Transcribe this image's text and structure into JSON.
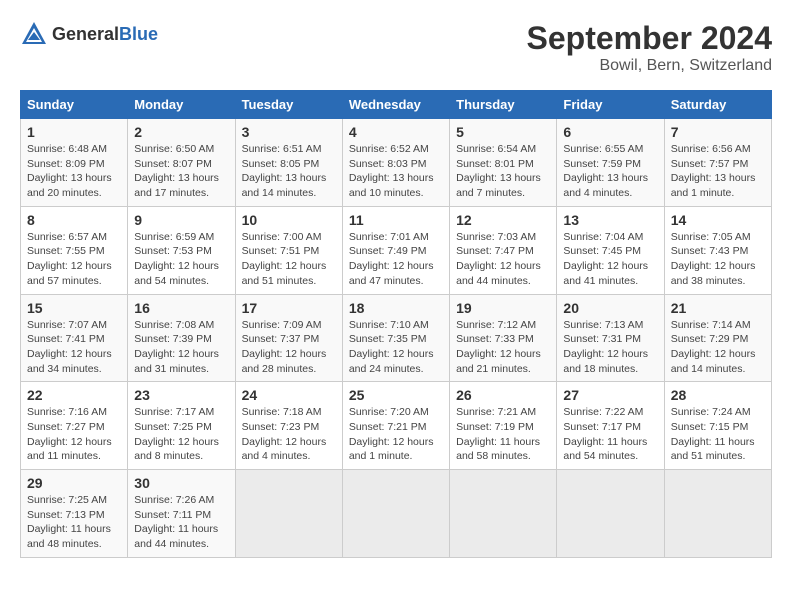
{
  "header": {
    "logo_general": "General",
    "logo_blue": "Blue",
    "month": "September 2024",
    "location": "Bowil, Bern, Switzerland"
  },
  "columns": [
    "Sunday",
    "Monday",
    "Tuesday",
    "Wednesday",
    "Thursday",
    "Friday",
    "Saturday"
  ],
  "weeks": [
    [
      {
        "day": "1",
        "sunrise": "6:48 AM",
        "sunset": "8:09 PM",
        "daylight": "13 hours and 20 minutes."
      },
      {
        "day": "2",
        "sunrise": "6:50 AM",
        "sunset": "8:07 PM",
        "daylight": "13 hours and 17 minutes."
      },
      {
        "day": "3",
        "sunrise": "6:51 AM",
        "sunset": "8:05 PM",
        "daylight": "13 hours and 14 minutes."
      },
      {
        "day": "4",
        "sunrise": "6:52 AM",
        "sunset": "8:03 PM",
        "daylight": "13 hours and 10 minutes."
      },
      {
        "day": "5",
        "sunrise": "6:54 AM",
        "sunset": "8:01 PM",
        "daylight": "13 hours and 7 minutes."
      },
      {
        "day": "6",
        "sunrise": "6:55 AM",
        "sunset": "7:59 PM",
        "daylight": "13 hours and 4 minutes."
      },
      {
        "day": "7",
        "sunrise": "6:56 AM",
        "sunset": "7:57 PM",
        "daylight": "13 hours and 1 minute."
      }
    ],
    [
      {
        "day": "8",
        "sunrise": "6:57 AM",
        "sunset": "7:55 PM",
        "daylight": "12 hours and 57 minutes."
      },
      {
        "day": "9",
        "sunrise": "6:59 AM",
        "sunset": "7:53 PM",
        "daylight": "12 hours and 54 minutes."
      },
      {
        "day": "10",
        "sunrise": "7:00 AM",
        "sunset": "7:51 PM",
        "daylight": "12 hours and 51 minutes."
      },
      {
        "day": "11",
        "sunrise": "7:01 AM",
        "sunset": "7:49 PM",
        "daylight": "12 hours and 47 minutes."
      },
      {
        "day": "12",
        "sunrise": "7:03 AM",
        "sunset": "7:47 PM",
        "daylight": "12 hours and 44 minutes."
      },
      {
        "day": "13",
        "sunrise": "7:04 AM",
        "sunset": "7:45 PM",
        "daylight": "12 hours and 41 minutes."
      },
      {
        "day": "14",
        "sunrise": "7:05 AM",
        "sunset": "7:43 PM",
        "daylight": "12 hours and 38 minutes."
      }
    ],
    [
      {
        "day": "15",
        "sunrise": "7:07 AM",
        "sunset": "7:41 PM",
        "daylight": "12 hours and 34 minutes."
      },
      {
        "day": "16",
        "sunrise": "7:08 AM",
        "sunset": "7:39 PM",
        "daylight": "12 hours and 31 minutes."
      },
      {
        "day": "17",
        "sunrise": "7:09 AM",
        "sunset": "7:37 PM",
        "daylight": "12 hours and 28 minutes."
      },
      {
        "day": "18",
        "sunrise": "7:10 AM",
        "sunset": "7:35 PM",
        "daylight": "12 hours and 24 minutes."
      },
      {
        "day": "19",
        "sunrise": "7:12 AM",
        "sunset": "7:33 PM",
        "daylight": "12 hours and 21 minutes."
      },
      {
        "day": "20",
        "sunrise": "7:13 AM",
        "sunset": "7:31 PM",
        "daylight": "12 hours and 18 minutes."
      },
      {
        "day": "21",
        "sunrise": "7:14 AM",
        "sunset": "7:29 PM",
        "daylight": "12 hours and 14 minutes."
      }
    ],
    [
      {
        "day": "22",
        "sunrise": "7:16 AM",
        "sunset": "7:27 PM",
        "daylight": "12 hours and 11 minutes."
      },
      {
        "day": "23",
        "sunrise": "7:17 AM",
        "sunset": "7:25 PM",
        "daylight": "12 hours and 8 minutes."
      },
      {
        "day": "24",
        "sunrise": "7:18 AM",
        "sunset": "7:23 PM",
        "daylight": "12 hours and 4 minutes."
      },
      {
        "day": "25",
        "sunrise": "7:20 AM",
        "sunset": "7:21 PM",
        "daylight": "12 hours and 1 minute."
      },
      {
        "day": "26",
        "sunrise": "7:21 AM",
        "sunset": "7:19 PM",
        "daylight": "11 hours and 58 minutes."
      },
      {
        "day": "27",
        "sunrise": "7:22 AM",
        "sunset": "7:17 PM",
        "daylight": "11 hours and 54 minutes."
      },
      {
        "day": "28",
        "sunrise": "7:24 AM",
        "sunset": "7:15 PM",
        "daylight": "11 hours and 51 minutes."
      }
    ],
    [
      {
        "day": "29",
        "sunrise": "7:25 AM",
        "sunset": "7:13 PM",
        "daylight": "11 hours and 48 minutes."
      },
      {
        "day": "30",
        "sunrise": "7:26 AM",
        "sunset": "7:11 PM",
        "daylight": "11 hours and 44 minutes."
      },
      null,
      null,
      null,
      null,
      null
    ]
  ]
}
